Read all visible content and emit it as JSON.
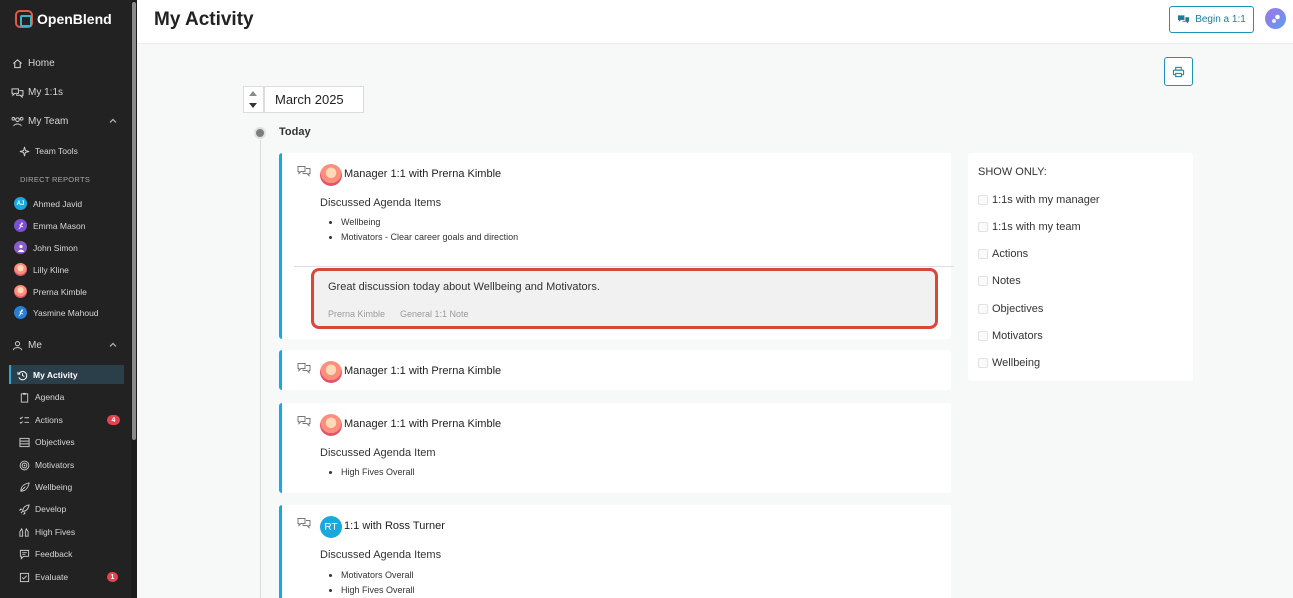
{
  "app": {
    "name": "OpenBlend"
  },
  "sidebar": {
    "home": "Home",
    "my_1on1s": "My 1:1s",
    "my_team": "My Team",
    "team_tools": "Team Tools",
    "direct_reports_label": "DIRECT REPORTS",
    "reports": [
      {
        "name": "Ahmed Javid",
        "initials": "AJ",
        "color": "#1aa9dc"
      },
      {
        "name": "Emma Mason",
        "initials": "",
        "color": "#7a4fd6"
      },
      {
        "name": "John Simon",
        "initials": "",
        "color": "#8a5cc7"
      },
      {
        "name": "Lilly Kline",
        "initials": "",
        "color": "#f08a6a"
      },
      {
        "name": "Prerna Kimble",
        "initials": "",
        "color": "#ef7a5c"
      },
      {
        "name": "Yasmine Mahoud",
        "initials": "",
        "color": "#2a7fd4"
      }
    ],
    "me": "Me",
    "me_items": [
      {
        "label": "My Activity",
        "icon": "history-icon"
      },
      {
        "label": "Agenda",
        "icon": "clipboard-icon"
      },
      {
        "label": "Actions",
        "icon": "checklist-icon",
        "badge": "4"
      },
      {
        "label": "Objectives",
        "icon": "list-icon"
      },
      {
        "label": "Motivators",
        "icon": "target-icon"
      },
      {
        "label": "Wellbeing",
        "icon": "leaf-icon"
      },
      {
        "label": "Develop",
        "icon": "rocket-icon"
      },
      {
        "label": "High Fives",
        "icon": "high-five-icon"
      },
      {
        "label": "Feedback",
        "icon": "feedback-icon"
      },
      {
        "label": "Evaluate",
        "icon": "evaluate-icon",
        "badge": "1"
      }
    ]
  },
  "header": {
    "title": "My Activity",
    "begin_button": "Begin a 1:1"
  },
  "month": {
    "label": "March 2025"
  },
  "timeline": {
    "today": "Today"
  },
  "cards": [
    {
      "title": "Manager 1:1 with Prerna Kimble",
      "subtitle": "Discussed Agenda Items",
      "items": [
        "Wellbeing",
        "Motivators - Clear career goals and direction"
      ],
      "note": {
        "text": "Great discussion today about Wellbeing and Motivators.",
        "author": "Prerna Kimble",
        "type": "General 1:1 Note"
      }
    },
    {
      "title": "Manager 1:1 with Prerna Kimble"
    },
    {
      "title": "Manager 1:1 with Prerna Kimble",
      "subtitle": "Discussed Agenda Item",
      "items": [
        "High Fives Overall"
      ]
    },
    {
      "title": "1:1 with Ross Turner",
      "avatar_initials": "RT",
      "subtitle": "Discussed Agenda Items",
      "items": [
        "Motivators Overall",
        "High Fives Overall"
      ]
    }
  ],
  "filter": {
    "title": "SHOW ONLY:",
    "options": [
      "1:1s with my manager",
      "1:1s with my team",
      "Actions",
      "Notes",
      "Objectives",
      "Motivators",
      "Wellbeing"
    ]
  },
  "colors": {
    "accent": "#1aa9dc",
    "sidebar_bg": "#222222",
    "highlight": "#d8473b",
    "badge": "#e3424e"
  }
}
